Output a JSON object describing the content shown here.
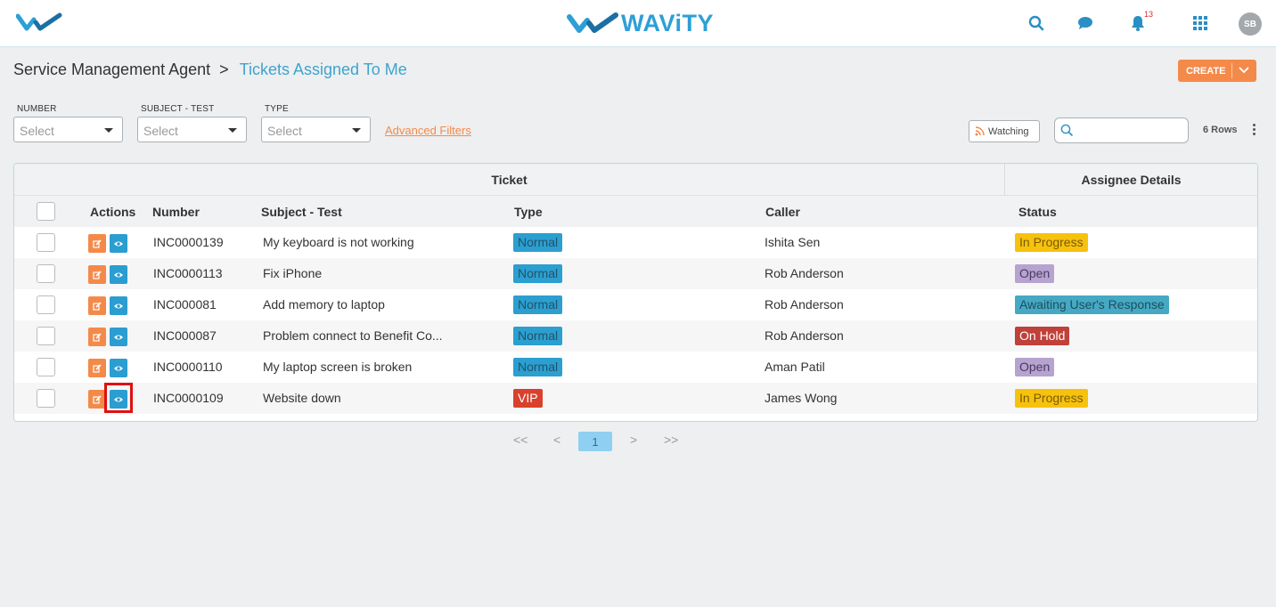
{
  "header": {
    "brand": "WAViTY",
    "notification_count": "13",
    "avatar_initials": "SB",
    "brand_color": "#2d9fd6"
  },
  "breadcrumb": {
    "root": "Service Management Agent",
    "separator": ">",
    "current": "Tickets Assigned To Me"
  },
  "create_button": {
    "label": "CREATE"
  },
  "filters": [
    {
      "label": "NUMBER",
      "placeholder": "Select"
    },
    {
      "label": "SUBJECT - TEST",
      "placeholder": "Select"
    },
    {
      "label": "TYPE",
      "placeholder": "Select"
    }
  ],
  "advanced_filters_label": "Advanced Filters",
  "watching_label": "Watching",
  "search": {
    "placeholder": "",
    "value": ""
  },
  "rows_count": "6 Rows",
  "table": {
    "group_headers": {
      "ticket": "Ticket",
      "assignee": "Assignee Details"
    },
    "columns": {
      "actions": "Actions",
      "number": "Number",
      "subject": "Subject - Test",
      "type": "Type",
      "caller": "Caller",
      "status": "Status"
    },
    "rows": [
      {
        "number": "INC0000139",
        "subject": "My keyboard is not working",
        "type": "Normal",
        "caller": "Ishita Sen",
        "status": "In Progress"
      },
      {
        "number": "INC0000113",
        "subject": "Fix iPhone",
        "type": "Normal",
        "caller": "Rob Anderson",
        "status": "Open"
      },
      {
        "number": "INC000081",
        "subject": "Add memory to laptop",
        "type": "Normal",
        "caller": "Rob Anderson",
        "status": "Awaiting User's Response"
      },
      {
        "number": "INC000087",
        "subject": "Problem connect to Benefit Co...",
        "type": "Normal",
        "caller": "Rob Anderson",
        "status": "On Hold"
      },
      {
        "number": "INC0000110",
        "subject": "My laptop screen is broken",
        "type": "Normal",
        "caller": "Aman Patil",
        "status": "Open"
      },
      {
        "number": "INC0000109",
        "subject": "Website down",
        "type": "VIP",
        "caller": "James Wong",
        "status": "In Progress"
      }
    ]
  },
  "badge_colors": {
    "Normal": {
      "bg": "#2b9fd0",
      "fg": "#23526a"
    },
    "VIP": {
      "bg": "#d9412c",
      "fg": "#ffffff"
    },
    "In Progress": {
      "bg": "#f7c20e",
      "fg": "#7a5a00"
    },
    "Open": {
      "bg": "#b6a3cf",
      "fg": "#4a3b63"
    },
    "Awaiting User's Response": {
      "bg": "#45a9c4",
      "fg": "#1f4d5c"
    },
    "On Hold": {
      "bg": "#c0403a",
      "fg": "#ffffff"
    }
  },
  "pagination": {
    "first": "<<",
    "prev": "<",
    "current_page": "1",
    "next": ">",
    "last": ">>"
  }
}
